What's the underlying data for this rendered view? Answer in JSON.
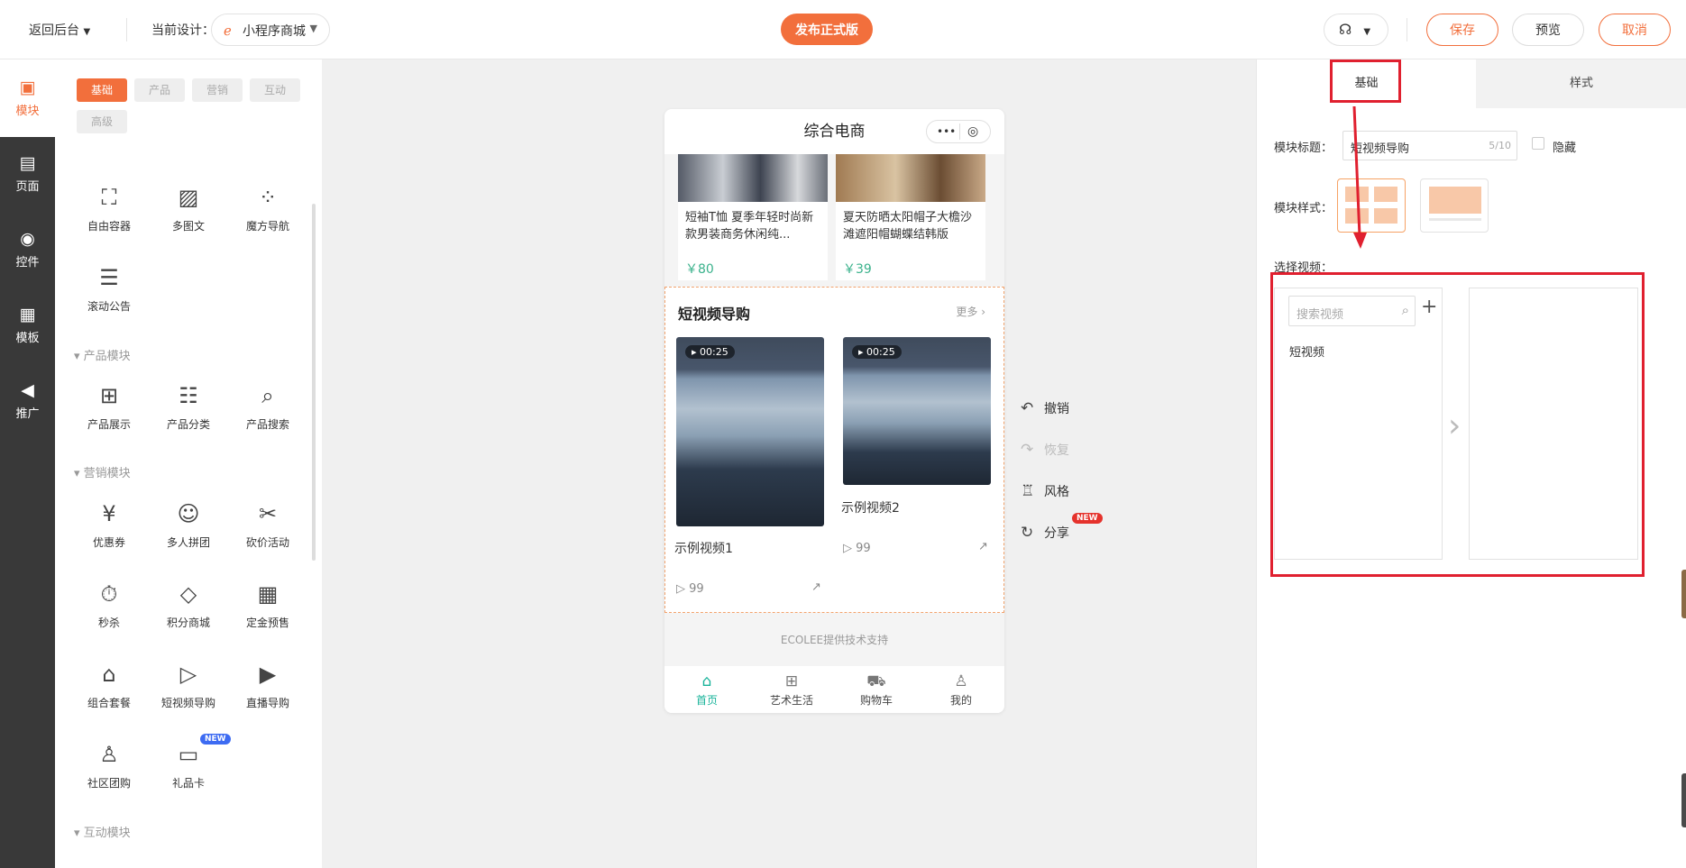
{
  "topbar": {
    "back": "返回后台",
    "current_design_label": "当前设计：",
    "design_select": "小程序商城",
    "publish": "发布正式版",
    "save": "保存",
    "preview": "预览",
    "cancel": "取消"
  },
  "rail": [
    {
      "label": "模块",
      "icon": "module-icon"
    },
    {
      "label": "页面",
      "icon": "page-icon"
    },
    {
      "label": "控件",
      "icon": "toggle-icon"
    },
    {
      "label": "模板",
      "icon": "template-icon"
    },
    {
      "label": "推广",
      "icon": "megaphone-icon"
    }
  ],
  "panel": {
    "chips": [
      "基础",
      "产品",
      "营销",
      "互动",
      "高级"
    ],
    "basic": [
      "自由容器",
      "多图文",
      "魔方导航",
      "滚动公告"
    ],
    "product_section": "产品模块",
    "product": [
      "产品展示",
      "产品分类",
      "产品搜索"
    ],
    "marketing_section": "营销模块",
    "marketing": [
      "优惠券",
      "多人拼团",
      "砍价活动",
      "秒杀",
      "积分商城",
      "定金预售",
      "组合套餐",
      "短视频导购",
      "直播导购",
      "社区团购",
      "礼品卡"
    ],
    "new_badge": "NEW",
    "interactive_section": "互动模块"
  },
  "phone": {
    "title": "综合电商",
    "capsule_dots": "•••",
    "products": [
      {
        "title": "短袖T恤 夏季年轻时尚新款男装商务休闲纯...",
        "price": "￥80"
      },
      {
        "title": "夏天防晒太阳帽子大檐沙滩遮阳帽蝴蝶结韩版",
        "price": "￥39"
      }
    ],
    "module_title": "短视频导购",
    "more": "更多 ›",
    "videos": [
      {
        "name": "示例视频1",
        "duration": "▸ 00:25",
        "views": "99"
      },
      {
        "name": "示例视频2",
        "duration": "▸ 00:25",
        "views": "99"
      }
    ],
    "footer_note": "ECOLEE提供技术支持",
    "tabs": [
      "首页",
      "艺术生活",
      "购物车",
      "我的"
    ]
  },
  "actions": [
    {
      "label": "撤销",
      "icon": "undo-icon"
    },
    {
      "label": "恢复",
      "icon": "redo-icon"
    },
    {
      "label": "风格",
      "icon": "shirt-icon"
    },
    {
      "label": "分享",
      "icon": "share-icon"
    }
  ],
  "right": {
    "tab_basic": "基础",
    "tab_style": "样式",
    "module_title_label": "模块标题：",
    "module_title_value": "短视频导购",
    "module_title_count": "5/10",
    "hide_label": "隐藏",
    "module_style_label": "模块样式：",
    "select_video_label": "选择视频：",
    "search_placeholder": "搜索视频",
    "category": "短视频"
  },
  "colors": {
    "accent": "#f26f3c",
    "annotation_red": "#e0202f",
    "tab_active": "#18b39a",
    "price": "#3bb28c"
  }
}
